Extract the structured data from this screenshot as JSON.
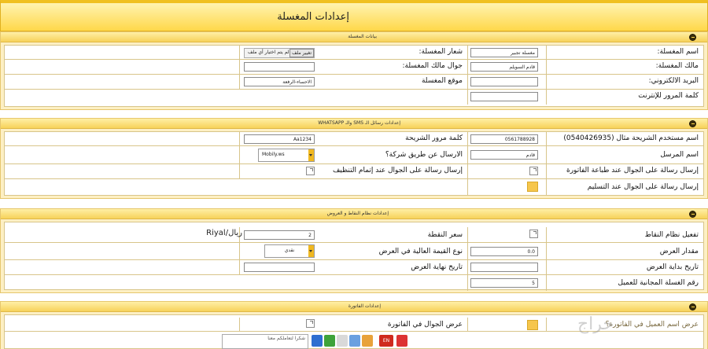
{
  "page": {
    "title": "إعدادات المغسلة"
  },
  "colors": {
    "header": "#ffd84a",
    "panel": "#fdf0c4",
    "swatch": "#f6c64c",
    "border": "#d8c58a"
  },
  "laundry_section": {
    "title": "بيانات المغسلة",
    "name_label": "اسم المغسلة:",
    "name_value": "مغسلة تجبير",
    "logo_label": "شعار المغسلة:",
    "logo_button": "تغيير ملف",
    "logo_status": "لم يتم اختيار أي ملف",
    "owner_label": "مالك المغسلة:",
    "owner_value": "قادم السويلم",
    "owner_mobile_label": "جوال مالك المغسلة:",
    "owner_mobile_value": "",
    "email_label": "البريد الالكتروني:",
    "email_value": "",
    "location_label": "موقع المغسلة",
    "location_value": "الاحساء-الرفعة",
    "password_label": "كلمة المرور للإنترنت",
    "password_value": ""
  },
  "sms_section": {
    "title": "إعدادات رسائل الـ SMS والـ WHATSAPP",
    "username_label": "اسم مستخدم الشريحة مثال (0540426935)",
    "username_value": "0561788928",
    "sim_password_label": "كلمة مرور الشريحة",
    "sim_password_value": "Aa1234",
    "sender_label": "اسم المرسل",
    "sender_value": "قادم",
    "company_label": "الارسال عن طريق شركة؟",
    "company_value": "Mobily.ws",
    "print_msg_label": "إرسال رسالة على الجوال عند طباعة الفاتورة",
    "clean_msg_label": "إرسال رسالة على الجوال عند إتمام التنظيف",
    "delivery_msg_label": "إرسال رسالة على الجوال عند التسليم"
  },
  "points_section": {
    "title": "إعدادات نظام النقاط و العروض",
    "enable_label": "تفعيل نظام النقاط",
    "point_price_label": "سعر النقطة",
    "point_price_value": "2",
    "currency": "ريال/Riyal",
    "offer_amount_label": "مقدار العرض",
    "offer_amount_value": "0.0",
    "value_type_label": "نوع القيمة العالية في العرض",
    "value_type_value": "نقدي",
    "start_date_label": "تاريخ بداية العرض",
    "start_date_value": "",
    "end_date_label": "تاريخ نهاية العرض",
    "end_date_value": "",
    "free_wash_label": "رقم الغسلة المجانية للعميل",
    "free_wash_value": "5"
  },
  "invoice_section": {
    "title": "إعدادات الفاتورة",
    "show_mobile_label": "عرض الجوال في الفاتورة",
    "show_customer_label": "عرض اسم العميل في الفاتورة؟",
    "note_text": "شكرا لتعاملكم معنا"
  },
  "taskbar": {
    "lang": "EN"
  },
  "watermark": "حراج"
}
